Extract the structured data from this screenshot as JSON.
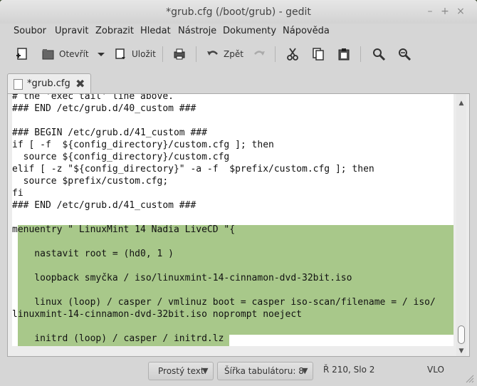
{
  "window": {
    "title": "*grub.cfg (/boot/grub) - gedit",
    "minimize": "–",
    "maximize": "+",
    "close": "×"
  },
  "menu": [
    "Soubor",
    "Upravit",
    "Zobrazit",
    "Hledat",
    "Nástroje",
    "Dokumenty",
    "Nápověda"
  ],
  "toolbar": {
    "open_label": "Otevřít",
    "save_label": "Uložit",
    "undo_label": "Zpět"
  },
  "tab": {
    "label": "*grub.cfg",
    "close": "✖"
  },
  "editor": {
    "lines": [
      "# the 'exec tail' line above.",
      "### END /etc/grub.d/40_custom ###",
      "",
      "### BEGIN /etc/grub.d/41_custom ###",
      "if [ -f  ${config_directory}/custom.cfg ]; then",
      "  source ${config_directory}/custom.cfg",
      "elif [ -z \"${config_directory}\" -a -f  $prefix/custom.cfg ]; then",
      "  source $prefix/custom.cfg;",
      "fi",
      "### END /etc/grub.d/41_custom ###",
      "",
      "menuentry \" LinuxMint 14 Nadia LiveCD \"{",
      "",
      "    nastavit root = (hd0, 1 )",
      "",
      "    loopback smyčka / iso/linuxmint-14-cinnamon-dvd-32bit.iso",
      "",
      "    linux (loop) / casper / vmlinuz boot = casper iso-scan/filename = / iso/",
      "linuxmint-14-cinnamon-dvd-32bit.iso noprompt noeject",
      "",
      "    initrd (loop) / casper / initrd.lz"
    ]
  },
  "status": {
    "language": "Prostý text",
    "tab_width": "Šířka tabulátoru:  8",
    "position": "Ř 210, Slo 2",
    "mode": "VLO"
  },
  "colors": {
    "selection": "#a8c88a",
    "window_bg": "#d6d6d6"
  }
}
